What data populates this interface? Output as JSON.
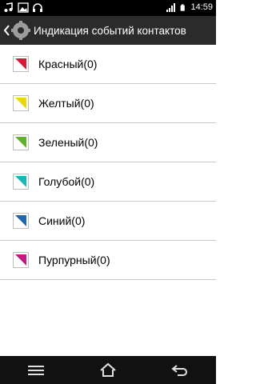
{
  "status_bar": {
    "time": "14:59",
    "icons": [
      "music-note-icon",
      "image-icon",
      "headphones-icon",
      "signal-icon",
      "battery-icon"
    ]
  },
  "action_bar": {
    "title": "Индикация событий контактов"
  },
  "colors": {
    "red": "#d21d3a",
    "yellow": "#e8d70c",
    "green": "#5fb32c",
    "cyan": "#19b6b8",
    "blue": "#1f66ad",
    "magenta": "#c2187f"
  },
  "items": [
    {
      "label": "Красный(0)",
      "color": "#d21d3a"
    },
    {
      "label": "Желтый(0)",
      "color": "#e8d70c"
    },
    {
      "label": "Зеленый(0)",
      "color": "#5fb32c"
    },
    {
      "label": "Голубой(0)",
      "color": "#19b6b8"
    },
    {
      "label": "Синий(0)",
      "color": "#1f66ad"
    },
    {
      "label": "Пурпурный(0)",
      "color": "#c2187f"
    }
  ],
  "nav_bar": {
    "icons": [
      "menu-icon",
      "home-icon",
      "back-icon"
    ]
  }
}
